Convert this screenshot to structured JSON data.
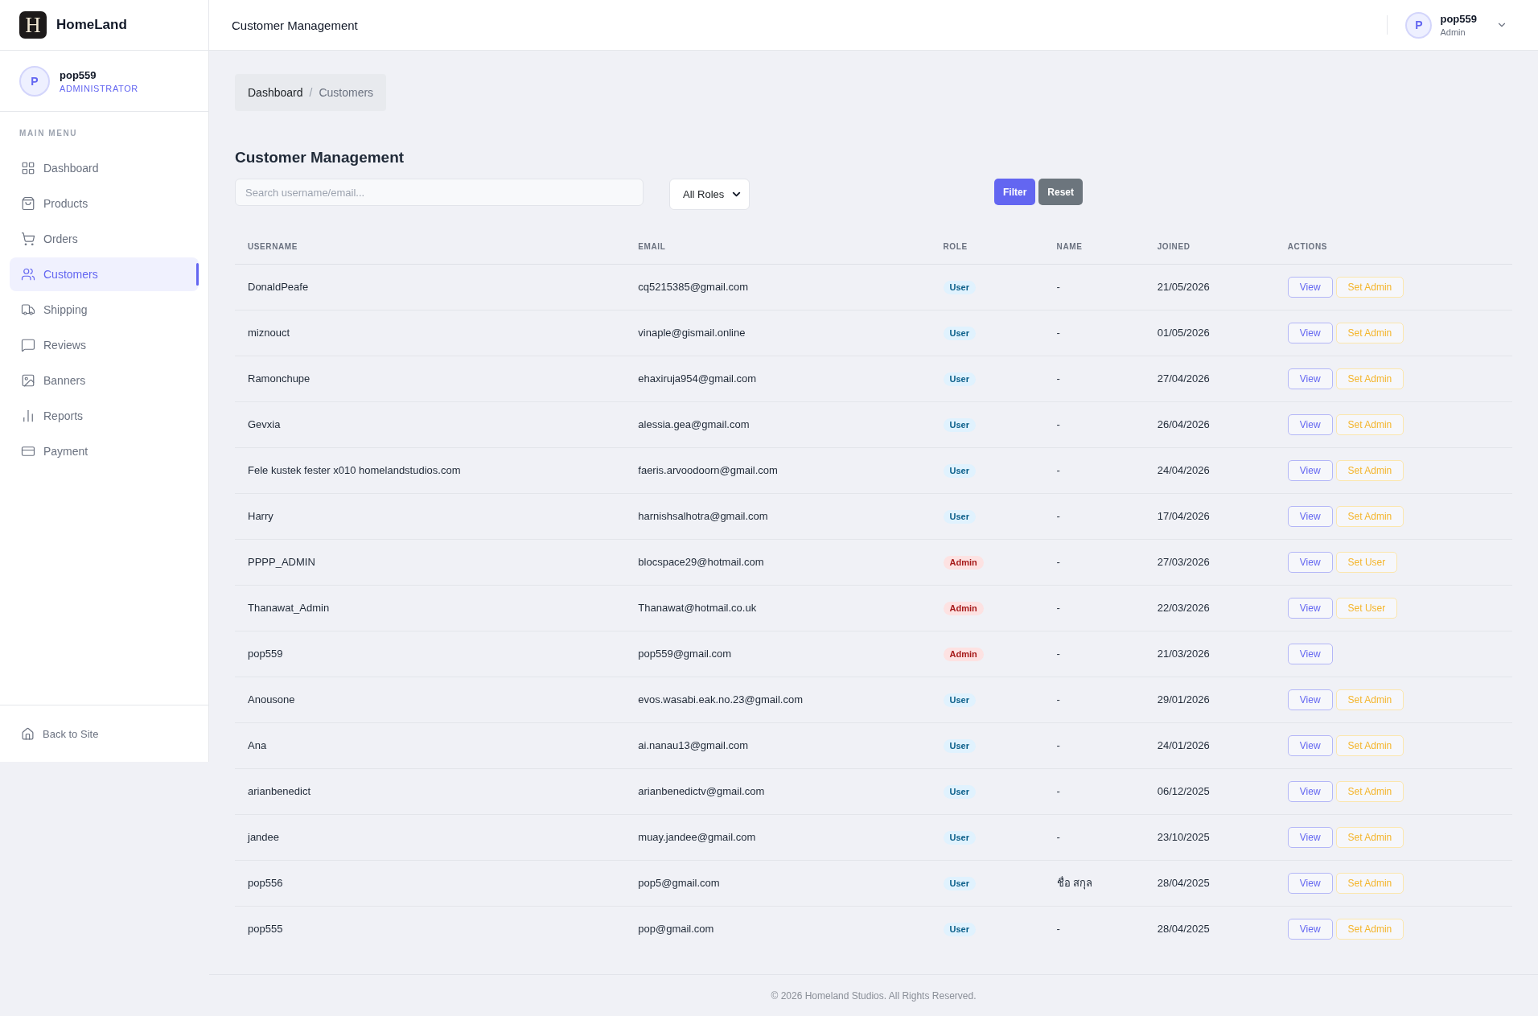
{
  "sidebar": {
    "brand": {
      "logo": "H",
      "name": "HomeLand"
    },
    "user": {
      "initial": "P",
      "name": "pop559",
      "role": "ADMINISTRATOR"
    },
    "menu_label": "MAIN MENU",
    "menu": [
      {
        "label": "Dashboard",
        "selected": false
      },
      {
        "label": "Products",
        "selected": false
      },
      {
        "label": "Orders",
        "selected": false
      },
      {
        "label": "Customers",
        "selected": true
      },
      {
        "label": "Shipping",
        "selected": false
      },
      {
        "label": "Reviews",
        "selected": false
      },
      {
        "label": "Banners",
        "selected": false
      },
      {
        "label": "Reports",
        "selected": false
      },
      {
        "label": "Payment",
        "selected": false
      }
    ],
    "back_link": "Back to Site"
  },
  "topbar": {
    "title": "Customer Management",
    "user": {
      "initial": "P",
      "name": "pop559",
      "role": "Admin"
    }
  },
  "breadcrumb": {
    "separator": "/",
    "items": [
      {
        "label": "Dashboard",
        "current": false
      },
      {
        "label": "Customers",
        "current": true
      }
    ]
  },
  "page_title": "Customer Management",
  "filters": {
    "search": {
      "placeholder": "Search username/email..."
    },
    "role_select": {
      "value": "All Roles"
    },
    "buttons": [
      {
        "label": "Filter",
        "kind": "primary"
      },
      {
        "label": "Reset",
        "kind": "secondary"
      }
    ]
  },
  "table": {
    "columns": [
      "USERNAME",
      "EMAIL",
      "ROLE",
      "NAME",
      "JOINED",
      "ACTIONS"
    ],
    "rows": [
      {
        "username": "DonaldPeafe",
        "email": "cq5215385@gmail.com",
        "role": {
          "label": "User",
          "kind": "user"
        },
        "name": "-",
        "joined": "21/05/2026",
        "actions": [
          {
            "label": "View",
            "kind": "view"
          },
          {
            "label": "Set Admin",
            "kind": "set_role"
          }
        ]
      },
      {
        "username": "miznouct",
        "email": "vinaple@gismail.online",
        "role": {
          "label": "User",
          "kind": "user"
        },
        "name": "-",
        "joined": "01/05/2026",
        "actions": [
          {
            "label": "View",
            "kind": "view"
          },
          {
            "label": "Set Admin",
            "kind": "set_role"
          }
        ]
      },
      {
        "username": "Ramonchupe",
        "email": "ehaxiruja954@gmail.com",
        "role": {
          "label": "User",
          "kind": "user"
        },
        "name": "-",
        "joined": "27/04/2026",
        "actions": [
          {
            "label": "View",
            "kind": "view"
          },
          {
            "label": "Set Admin",
            "kind": "set_role"
          }
        ]
      },
      {
        "username": "Gevxia",
        "email": "alessia.gea@gmail.com",
        "role": {
          "label": "User",
          "kind": "user"
        },
        "name": "-",
        "joined": "26/04/2026",
        "actions": [
          {
            "label": "View",
            "kind": "view"
          },
          {
            "label": "Set Admin",
            "kind": "set_role"
          }
        ]
      },
      {
        "username": "Fele kustek fester x010 homelandstudios.com",
        "email": "faeris.arvoodoorn@gmail.com",
        "role": {
          "label": "User",
          "kind": "user"
        },
        "name": "-",
        "joined": "24/04/2026",
        "actions": [
          {
            "label": "View",
            "kind": "view"
          },
          {
            "label": "Set Admin",
            "kind": "set_role"
          }
        ]
      },
      {
        "username": "Harry",
        "email": "harnishsalhotra@gmail.com",
        "role": {
          "label": "User",
          "kind": "user"
        },
        "name": "-",
        "joined": "17/04/2026",
        "actions": [
          {
            "label": "View",
            "kind": "view"
          },
          {
            "label": "Set Admin",
            "kind": "set_role"
          }
        ]
      },
      {
        "username": "PPPP_ADMIN",
        "email": "blocspace29@hotmail.com",
        "role": {
          "label": "Admin",
          "kind": "admin"
        },
        "name": "-",
        "joined": "27/03/2026",
        "actions": [
          {
            "label": "View",
            "kind": "view"
          },
          {
            "label": "Set User",
            "kind": "set_role"
          }
        ]
      },
      {
        "username": "Thanawat_Admin",
        "email": "Thanawat@hotmail.co.uk",
        "role": {
          "label": "Admin",
          "kind": "admin"
        },
        "name": "-",
        "joined": "22/03/2026",
        "actions": [
          {
            "label": "View",
            "kind": "view"
          },
          {
            "label": "Set User",
            "kind": "set_role"
          }
        ]
      },
      {
        "username": "pop559",
        "email": "pop559@gmail.com",
        "role": {
          "label": "Admin",
          "kind": "admin"
        },
        "name": "-",
        "joined": "21/03/2026",
        "actions": [
          {
            "label": "View",
            "kind": "view"
          }
        ]
      },
      {
        "username": "Anousone",
        "email": "evos.wasabi.eak.no.23@gmail.com",
        "role": {
          "label": "User",
          "kind": "user"
        },
        "name": "-",
        "joined": "29/01/2026",
        "actions": [
          {
            "label": "View",
            "kind": "view"
          },
          {
            "label": "Set Admin",
            "kind": "set_role"
          }
        ]
      },
      {
        "username": "Ana",
        "email": "ai.nanau13@gmail.com",
        "role": {
          "label": "User",
          "kind": "user"
        },
        "name": "-",
        "joined": "24/01/2026",
        "actions": [
          {
            "label": "View",
            "kind": "view"
          },
          {
            "label": "Set Admin",
            "kind": "set_role"
          }
        ]
      },
      {
        "username": "arianbenedict",
        "email": "arianbenedictv@gmail.com",
        "role": {
          "label": "User",
          "kind": "user"
        },
        "name": "-",
        "joined": "06/12/2025",
        "actions": [
          {
            "label": "View",
            "kind": "view"
          },
          {
            "label": "Set Admin",
            "kind": "set_role"
          }
        ]
      },
      {
        "username": "jandee",
        "email": "muay.jandee@gmail.com",
        "role": {
          "label": "User",
          "kind": "user"
        },
        "name": "-",
        "joined": "23/10/2025",
        "actions": [
          {
            "label": "View",
            "kind": "view"
          },
          {
            "label": "Set Admin",
            "kind": "set_role"
          }
        ]
      },
      {
        "username": "pop556",
        "email": "pop5@gmail.com",
        "role": {
          "label": "User",
          "kind": "user"
        },
        "name": "ชื่อ สกุล",
        "joined": "28/04/2025",
        "actions": [
          {
            "label": "View",
            "kind": "view"
          },
          {
            "label": "Set Admin",
            "kind": "set_role"
          }
        ]
      },
      {
        "username": "pop555",
        "email": "pop@gmail.com",
        "role": {
          "label": "User",
          "kind": "user"
        },
        "name": "-",
        "joined": "28/04/2025",
        "actions": [
          {
            "label": "View",
            "kind": "view"
          },
          {
            "label": "Set Admin",
            "kind": "set_role"
          }
        ]
      }
    ]
  },
  "footer": "© 2026 Homeland Studios. All Rights Reserved."
}
